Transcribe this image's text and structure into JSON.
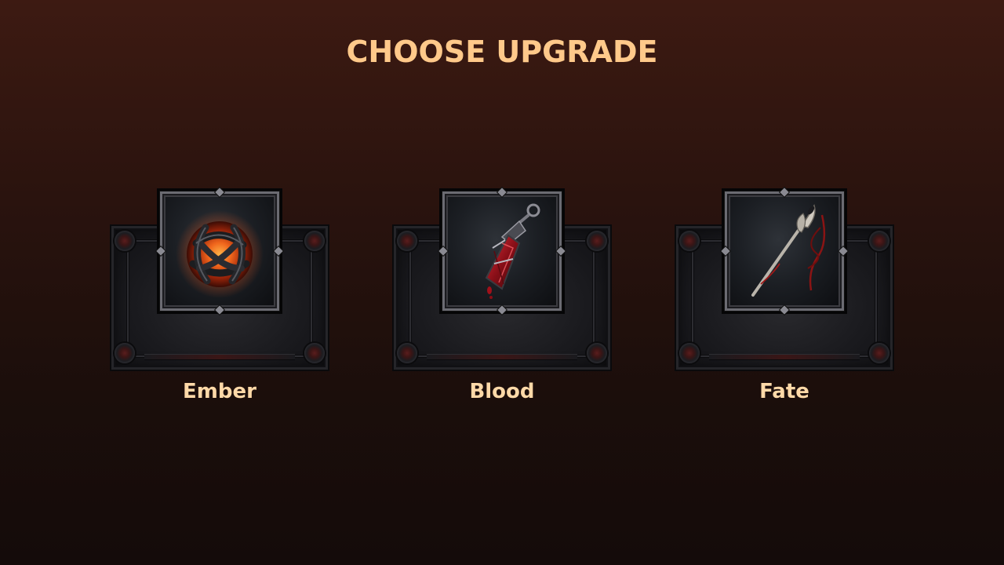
{
  "screen": {
    "title": "CHOOSE UPGRADE"
  },
  "upgrades": [
    {
      "label": "Ember",
      "icon": "ember-orb-icon",
      "accent": "#e04a14"
    },
    {
      "label": "Blood",
      "icon": "blood-pendant-icon",
      "accent": "#a0141e"
    },
    {
      "label": "Fate",
      "icon": "fate-needle-icon",
      "accent": "#8a1a1a"
    }
  ],
  "colors": {
    "title": "#ffc98a",
    "label": "#ffd9a8",
    "background_top": "#3d1a12",
    "background_bottom": "#140b0a"
  }
}
